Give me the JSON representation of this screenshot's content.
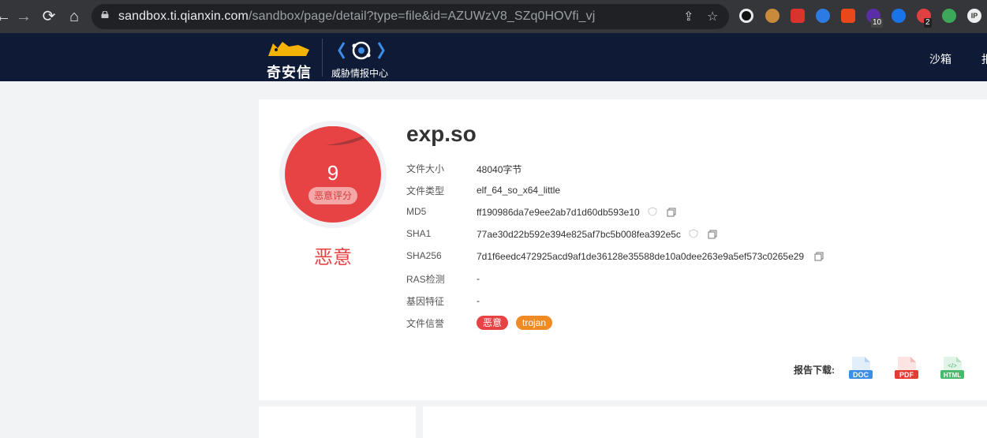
{
  "browser": {
    "url_host": "sandbox.ti.qianxin.com",
    "url_path": "/sandbox/page/detail?type=file&id=AZUWzV8_SZq0HOVfi_vj",
    "extension_badges": [
      "10",
      "2"
    ]
  },
  "site": {
    "logo_text": "奇安信",
    "center_name": "威胁情报中心",
    "nav_items": [
      "沙箱",
      "报"
    ]
  },
  "file": {
    "score": "9",
    "score_label": "恶意评分",
    "verdict": "恶意",
    "name": "exp.so",
    "rows": [
      {
        "label": "文件大小",
        "value": "48040字节"
      },
      {
        "label": "文件类型",
        "value": "elf_64_so_x64_little"
      },
      {
        "label": "MD5",
        "value": "ff190986da7e9ee2ab7d1d60db593e10"
      },
      {
        "label": "SHA1",
        "value": "77ae30d22b592e394e825af7bc5b008fea392e5c"
      },
      {
        "label": "SHA256",
        "value": "7d1f6eedc472925acd9af1de36128e35588de10a0dee263e9a5ef573c0265e29"
      },
      {
        "label": "RAS检测",
        "value": "-"
      },
      {
        "label": "基因特征",
        "value": "-"
      },
      {
        "label": "文件信誉",
        "value": ""
      }
    ],
    "tags": [
      {
        "text": "恶意",
        "color": "#e74345"
      },
      {
        "text": "trojan",
        "color": "#f08a24"
      }
    ]
  },
  "report": {
    "label": "报告下载:",
    "formats": [
      {
        "name": "DOC",
        "color": "#3d8ee6"
      },
      {
        "name": "PDF",
        "color": "#e23c33"
      },
      {
        "name": "HTML",
        "color": "#49b96e"
      }
    ]
  }
}
